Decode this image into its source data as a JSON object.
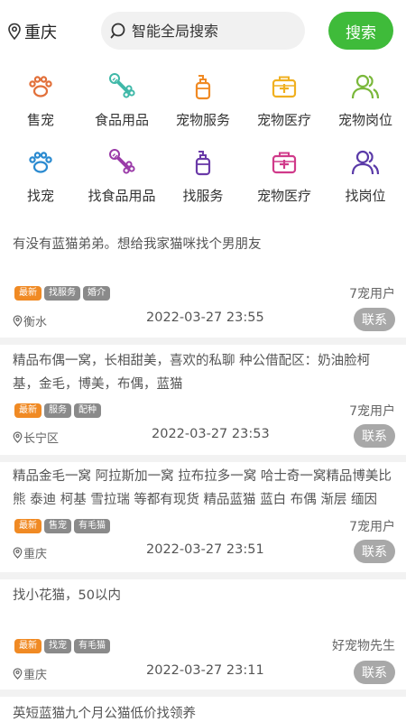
{
  "header": {
    "city": "重庆",
    "search_placeholder": "智能全局搜索",
    "search_button": "搜索"
  },
  "categories_row1": [
    "售宠",
    "食品用品",
    "宠物服务",
    "宠物医疗",
    "宠物岗位"
  ],
  "categories_row2": [
    "找宠",
    "找食品用品",
    "找服务",
    "宠物医疗",
    "找岗位"
  ],
  "icons": {
    "paw": "paw-icon",
    "bone": "bone-icon",
    "bottle": "shampoo-bottle-icon",
    "kit": "medical-kit-icon",
    "people": "people-icon"
  },
  "colors": {
    "accent_green": "#3fbb3a",
    "tag_new": "#f08a24",
    "tag_gray": "#8a8a8a",
    "contact_gray": "#a8a8a8",
    "row1_paw": "#e2703a",
    "row1_bone": "#3fb8a8",
    "row1_bottle": "#f08a24",
    "row1_kit": "#f0b020",
    "row1_people": "#7ab83a",
    "row2_paw": "#2a8ad0",
    "row2_bone": "#9a3aa8",
    "row2_bottle": "#6a3aa8",
    "row2_kit": "#d03a8a",
    "row2_people": "#5a3aa8"
  },
  "posts": [
    {
      "text": "有没有蓝猫弟弟。想给我家猫咪找个男朋友",
      "tags": [
        "最新",
        "找服务",
        "婚介"
      ],
      "author": "7宠用户",
      "location": "衡水",
      "time": "2022-03-27 23:55",
      "contact": "联系"
    },
    {
      "text": "精品布偶一窝，长相甜美，喜欢的私聊 种公借配区：奶油脸柯基，金毛，博美，布偶，蓝猫",
      "tags": [
        "最新",
        "服务",
        "配种"
      ],
      "author": "7宠用户",
      "location": "长宁区",
      "time": "2022-03-27 23:53",
      "contact": "联系"
    },
    {
      "text": "精品金毛一窝 阿拉斯加一窝 拉布拉多一窝 哈士奇一窝精品博美比熊 泰迪 柯基 雪拉瑞 等都有现货 精品蓝猫 蓝白 布偶 渐层 缅因",
      "tags": [
        "最新",
        "售宠",
        "有毛猫"
      ],
      "author": "7宠用户",
      "location": "重庆",
      "time": "2022-03-27 23:51",
      "contact": "联系"
    },
    {
      "text": "找小花猫，50以内",
      "tags": [
        "最新",
        "找宠",
        "有毛猫"
      ],
      "author": "好宠物先生",
      "location": "重庆",
      "time": "2022-03-27 23:11",
      "contact": "联系"
    },
    {
      "text": "英短蓝猫九个月公猫低价找领养"
    }
  ]
}
